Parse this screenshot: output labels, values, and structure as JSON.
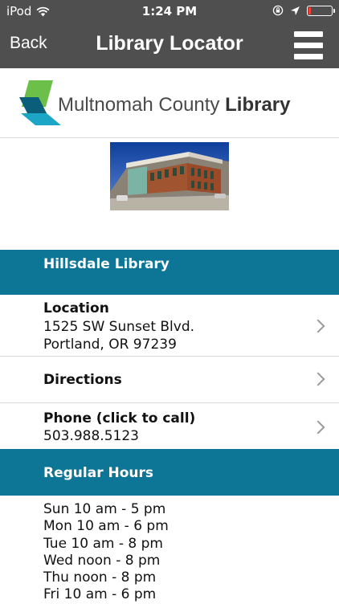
{
  "status": {
    "carrier": "iPod",
    "time": "1:24 PM",
    "battery_level": 0.12
  },
  "nav": {
    "back": "Back",
    "title": "Library Locator",
    "menu_icon": "hamburger-menu-icon"
  },
  "logo": {
    "text_regular": "Multnomah County ",
    "text_bold": "Library"
  },
  "branch": {
    "name": "Hillsdale Library",
    "location": {
      "label": "Location",
      "line1": "1525 SW Sunset Blvd.",
      "line2": "Portland, OR 97239"
    },
    "directions": {
      "label": "Directions"
    },
    "phone": {
      "label": "Phone (click to call)",
      "number": "503.988.5123"
    }
  },
  "hours": {
    "header": "Regular Hours",
    "days": [
      "Sun 10 am - 5 pm",
      "Mon 10 am - 6 pm",
      "Tue 10 am - 8 pm",
      "Wed noon - 8 pm",
      "Thu noon - 8 pm",
      "Fri 10 am - 6 pm"
    ]
  },
  "colors": {
    "nav_bg": "#4f4f4f",
    "section_bg": "#0d7596",
    "logo_green": "#6cc04a",
    "logo_teal": "#1aa6c4",
    "logo_dark": "#0b5e7a"
  }
}
